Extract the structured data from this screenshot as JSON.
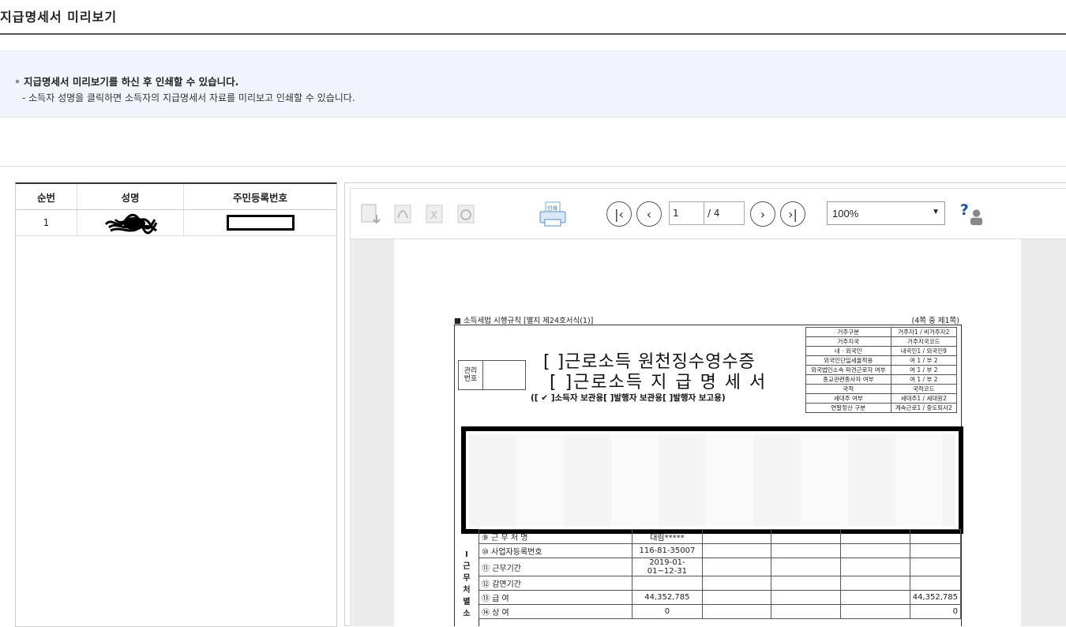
{
  "page": {
    "title": "지급명세서 미리보기",
    "info_main": "지급명세서 미리보기를 하신 후 인쇄할 수 있습니다.",
    "info_sub": "- 소득자 성명을 클릭하면 소득자의 지급명세서 자료를 미리보고 인쇄할 수 있습니다."
  },
  "list": {
    "headers": {
      "no": "순번",
      "name": "성명",
      "id": "주민등록번호"
    },
    "rows": [
      {
        "no": "1"
      }
    ]
  },
  "viewer": {
    "current_page": "1",
    "total_pages": "/ 4",
    "zoom": "100%",
    "print_label": "인쇄"
  },
  "form": {
    "header_left": "■ 소득세법 시행규칙 [별지 제24호서식(1)]",
    "header_right": "(4쪽 중 제1쪽)",
    "mgmt_label": "관리\n번호",
    "title1": "[  ]근로소득 원천징수영수증",
    "title2": "[  ]근로소득 지 급 명 세 서",
    "copies": "([ ✔ ]소득자 보관용[    ]발행자 보관용[    ]발행자 보고용)",
    "right_grid": [
      [
        "거주구분",
        "거주자1 / 비거주자2"
      ],
      [
        "거주지국",
        "거주지국코드"
      ],
      [
        "내 · 외국인",
        "내국인1 / 외국인9"
      ],
      [
        "외국인단일세율적용",
        "여 1 / 부 2"
      ],
      [
        "외국법인소속 파견근로자 여부",
        "여 1 / 부 2"
      ],
      [
        "종교관련종사자 여부",
        "여 1 / 부 2"
      ],
      [
        "국적",
        "국적코드"
      ],
      [
        "세대주 여부",
        "세대주1 / 세대원2"
      ],
      [
        "연말정산 구분",
        "계속근로1 / 중도퇴사2"
      ]
    ],
    "side_label": [
      "I",
      "근",
      "무",
      "처",
      "별",
      "소"
    ],
    "rows": [
      {
        "label": "⑨ 근 무 처 명",
        "v1": "대림*****",
        "v2": ""
      },
      {
        "label": "⑩ 사업자등록번호",
        "v1": "116-81-35007",
        "v2": ""
      },
      {
        "label": "⑪ 근무기간",
        "v1": "2019-01-01~12-31",
        "v2": ""
      },
      {
        "label": "⑫ 감면기간",
        "v1": "",
        "v2": ""
      },
      {
        "label": "⑬ 급          여",
        "v1": "44,352,785",
        "v2": "44,352,785"
      },
      {
        "label": "⑭ 상          여",
        "v1": "0",
        "v2": "0"
      }
    ]
  }
}
